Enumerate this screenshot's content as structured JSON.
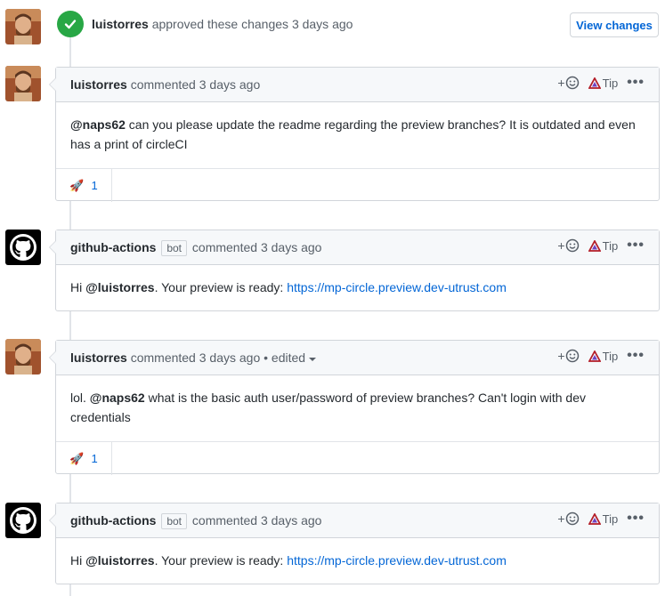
{
  "approval": {
    "user": "luistorres",
    "text": "approved these changes",
    "time": "3 days ago",
    "view_changes": "View changes"
  },
  "comments": [
    {
      "user": "luistorres",
      "verb": "commented",
      "time": "3 days ago",
      "bot": "",
      "edited": "",
      "body_mention": "@naps62",
      "body_text": "can you please update the readme regarding the preview branches? It is outdated and even has a print of circleCI",
      "reaction_count": "1"
    },
    {
      "user": "github-actions",
      "bot": "bot",
      "verb": "commented",
      "time": "3 days ago",
      "body_prefix": "Hi",
      "body_mention": "@luistorres",
      "body_text": ". Your preview is ready:",
      "link": "https://mp-circle.preview.dev-utrust.com"
    },
    {
      "user": "luistorres",
      "verb": "commented",
      "time": "3 days ago",
      "edited": "• edited",
      "body_prefix": "lol.",
      "body_mention": "@naps62",
      "body_text": "what is the basic auth user/password of preview branches? Can't login with dev credentials",
      "reaction_count": "1"
    },
    {
      "user": "github-actions",
      "bot": "bot",
      "verb": "commented",
      "time": "3 days ago",
      "body_prefix": "Hi",
      "body_mention": "@luistorres",
      "body_text": ". Your preview is ready:",
      "link": "https://mp-circle.preview.dev-utrust.com"
    }
  ],
  "actions": {
    "tip_label": "Tip",
    "more_label": "•••",
    "add_reaction": "+"
  },
  "colors": {
    "link": "#0366d6",
    "approved": "#28a745",
    "header_bg": "#f6f8fa"
  },
  "icons": [
    "check-icon",
    "smiley-icon",
    "tip-triangle-icon",
    "kebab-icon",
    "rocket-icon",
    "github-octocat-icon",
    "caret-down-icon"
  ]
}
